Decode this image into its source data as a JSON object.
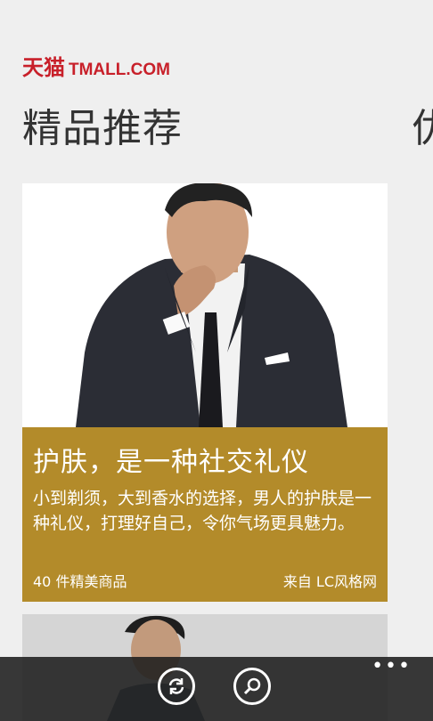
{
  "header": {
    "logo_cn": "天猫",
    "logo_en": "TMALL.COM",
    "title": "精品推荐",
    "next_title_fragment": "优"
  },
  "card": {
    "headline": "护肤，是一种社交礼仪",
    "description": "小到剃须，大到香水的选择，男人的护肤是一种礼仪，打理好自己，令你气场更具魅力。",
    "count": "40 件精美商品",
    "source": "来自 LC风格网"
  },
  "app_bar": {
    "more": "•••",
    "icons": [
      "refresh-icon",
      "search-icon"
    ]
  },
  "colors": {
    "brand": "#c8202a",
    "card_panel": "#b38b2a",
    "background": "#efefef"
  }
}
